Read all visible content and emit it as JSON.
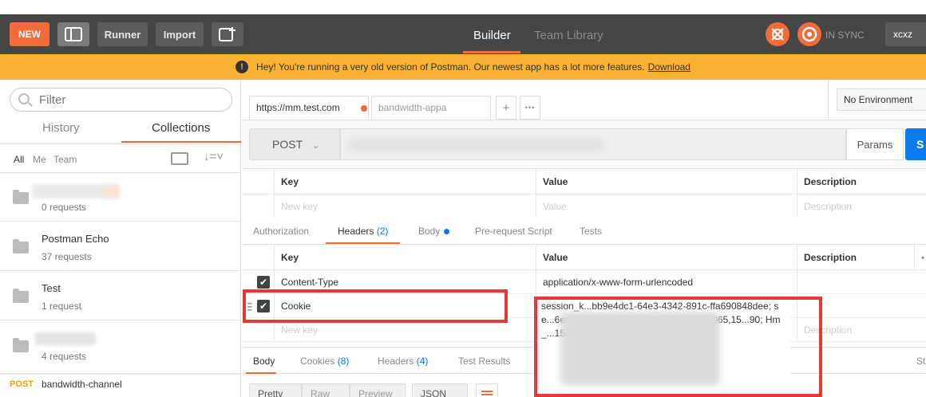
{
  "toolbar": {
    "new_label": "NEW",
    "runner_label": "Runner",
    "import_label": "Import",
    "tab_builder": "Builder",
    "tab_team_library": "Team Library",
    "sync_status": "IN SYNC",
    "user_name": "xcxz",
    "accent_color": "#f26b3a"
  },
  "banner": {
    "message": "Hey! You're running a very old version of Postman. Our newest app has a lot more features.",
    "link": "Download",
    "icon_glyph": "!"
  },
  "sidebar": {
    "filter_placeholder": "Filter",
    "tab_history": "History",
    "tab_collections": "Collections",
    "filters": [
      "All",
      "Me",
      "Team"
    ],
    "sort_glyph": "↓=˅",
    "collections": [
      {
        "name": "",
        "count": "0 requests"
      },
      {
        "name": "Postman Echo",
        "count": "37 requests"
      },
      {
        "name": "Test",
        "count": "1 request"
      },
      {
        "name": "",
        "count": "4 requests"
      }
    ],
    "history_item": {
      "method": "POST",
      "name": "bandwidth-channel"
    }
  },
  "request": {
    "tabs": [
      {
        "label": "https://mm.test.com"
      },
      {
        "label": "bandwidth-appa"
      }
    ],
    "add_tab_glyph": "+",
    "more_glyph": "•••",
    "environment": "No Environment",
    "method": "POST",
    "method_chevron": "⌄",
    "params_label": "Params",
    "send_label": "S",
    "params_table": {
      "headers": [
        "Key",
        "Value",
        "Description"
      ],
      "placeholders": {
        "key": "New key",
        "value": "Value",
        "description": "Description"
      }
    },
    "subtabs": {
      "authorization": "Authorization",
      "headers": "Headers",
      "headers_count": "(2)",
      "body": "Body",
      "pre_request": "Pre-request Script",
      "tests": "Tests"
    },
    "headers_table": {
      "headers": [
        "Key",
        "Value",
        "Description"
      ],
      "more_glyph": "•",
      "rows": [
        {
          "key": "Content-Type",
          "value": "application/x-www-form-urlencoded",
          "checked": true
        },
        {
          "key": "Cookie",
          "checked": true
        }
      ],
      "new_key_placeholder": "New key",
      "new_desc_placeholder": "Description"
    },
    "cookie_value_visible": "session_k...bb9e4dc1-64e3-4342-891c-ffa690848dee; se...6ea6099; JS...12E3; Hm_...1538034 065,15...90; Hm_...15380 365"
  },
  "response": {
    "tab_body": "Body",
    "tab_cookies": "Cookies",
    "cookies_count": "(8)",
    "tab_headers": "Headers",
    "headers_count": "(4)",
    "tab_test_results": "Test Results",
    "right_label": "St",
    "format_pretty": "Pretty",
    "format_raw": "Raw",
    "format_preview": "Preview",
    "format_type": "JSON"
  }
}
